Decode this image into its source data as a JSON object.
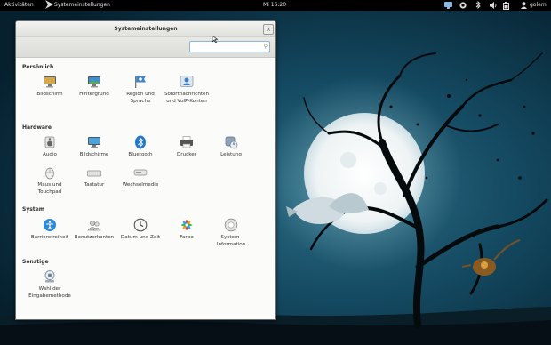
{
  "topbar": {
    "activities": "Aktivitäten",
    "app_menu": "Systemeinstellungen",
    "clock": "Mi 16:20",
    "user": "golem"
  },
  "window": {
    "title": "Systemeinstellungen",
    "search_placeholder": "",
    "search_value": ""
  },
  "sections": {
    "personal": {
      "title": "Persönlich",
      "items": [
        {
          "label": "Bildschirm",
          "icon": "display-icon"
        },
        {
          "label": "Hintergrund",
          "icon": "background-icon"
        },
        {
          "label": "Region und Sprache",
          "icon": "region-flag-icon"
        },
        {
          "label": "Sofortnachrichten und VoIP-Konten",
          "icon": "online-accounts-icon"
        }
      ]
    },
    "hardware": {
      "title": "Hardware",
      "items": [
        {
          "label": "Audio",
          "icon": "speaker-icon"
        },
        {
          "label": "Bildschirme",
          "icon": "monitor-icon"
        },
        {
          "label": "Bluetooth",
          "icon": "bluetooth-icon"
        },
        {
          "label": "Drucker",
          "icon": "printer-icon"
        },
        {
          "label": "Leistung",
          "icon": "power-icon"
        },
        {
          "label": "Maus und Touchpad",
          "icon": "mouse-icon"
        },
        {
          "label": "Tastatur",
          "icon": "keyboard-icon"
        },
        {
          "label": "Wechselmedie",
          "icon": "removable-media-icon"
        }
      ]
    },
    "system": {
      "title": "System",
      "items": [
        {
          "label": "Barrierefreiheit",
          "icon": "accessibility-icon"
        },
        {
          "label": "Benutzerkonten",
          "icon": "users-icon"
        },
        {
          "label": "Datum und Zeit",
          "icon": "clock-icon"
        },
        {
          "label": "Farbe",
          "icon": "color-icon"
        },
        {
          "label": "System-Information",
          "icon": "system-info-icon"
        }
      ]
    },
    "other": {
      "title": "Sonstige",
      "items": [
        {
          "label": "Wahl der Eingabemethode",
          "icon": "input-method-icon"
        }
      ]
    }
  },
  "colors": {
    "topbar": "#000000",
    "window_bg": "#fbfbfa",
    "bluetooth_blue": "#1f7ad0",
    "accessibility_blue": "#2a8bd6",
    "wallpaper_sky": "#0e3a50"
  }
}
